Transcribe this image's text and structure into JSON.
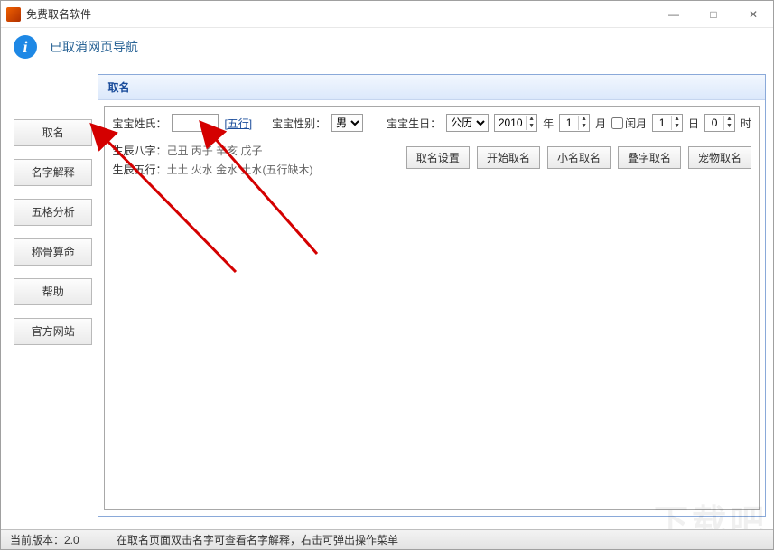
{
  "window": {
    "title": "免费取名软件"
  },
  "info": {
    "text": "已取消网页导航"
  },
  "sidebar": {
    "items": [
      {
        "label": "取名"
      },
      {
        "label": "名字解释"
      },
      {
        "label": "五格分析"
      },
      {
        "label": "称骨算命"
      },
      {
        "label": "帮助"
      },
      {
        "label": "官方网站"
      }
    ]
  },
  "panel": {
    "title": "取名",
    "surname_label": "宝宝姓氏：",
    "surname_value": "",
    "wuxing_link": "[五行]",
    "gender_label": "宝宝性别：",
    "gender_value": "男",
    "birth_label": "宝宝生日：",
    "calendar_value": "公历",
    "year_value": "2010",
    "year_suffix": "年",
    "month_value": "1",
    "month_suffix": "月",
    "leap_label": "闰月",
    "day_value": "1",
    "day_suffix": "日",
    "hour_value": "0",
    "hour_suffix": "时",
    "bazi_label": "生辰八字：",
    "bazi_value": "己丑 丙子 辛亥 戊子",
    "wuxing_label": "生辰五行：",
    "wuxing_value": "土土 火水 金水 土水(五行缺木)",
    "buttons": [
      {
        "label": "取名设置"
      },
      {
        "label": "开始取名"
      },
      {
        "label": "小名取名"
      },
      {
        "label": "叠字取名"
      },
      {
        "label": "宠物取名"
      }
    ]
  },
  "status": {
    "version": "当前版本：2.0",
    "hint": "在取名页面双击名字可查看名字解释，右击可弹出操作菜单"
  },
  "watermark": "下载吧"
}
